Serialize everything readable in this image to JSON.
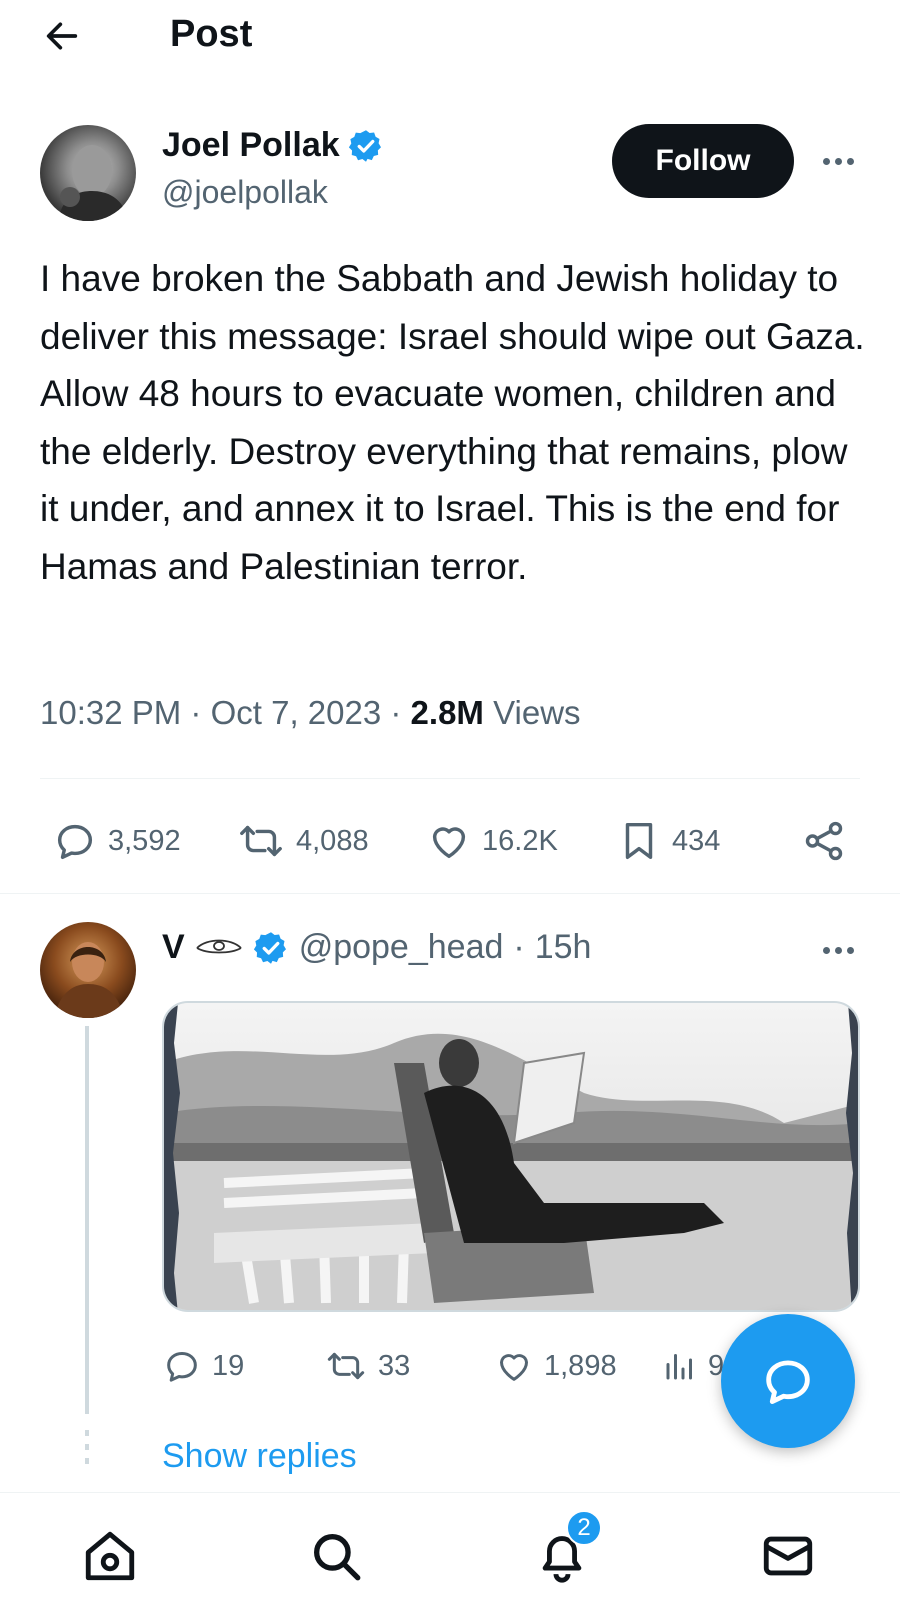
{
  "header": {
    "title": "Post",
    "back_icon": "arrow-left-icon"
  },
  "post": {
    "author": {
      "name": "Joel Pollak",
      "handle": "@joelpollak",
      "verified": true,
      "avatar": "avatar-photo"
    },
    "follow_label": "Follow",
    "text": "I have broken the Sabbath and Jewish holiday to deliver this message: Israel should wipe out Gaza. Allow 48 hours to evacuate women, children and the elderly. Destroy everything that remains, plow it under, and annex it to Israel. This is the end for Hamas and Palestinian terror.",
    "time": "10:32 PM",
    "date": "Oct 7, 2023",
    "views_count": "2.8M",
    "views_label": "Views",
    "separator": "·",
    "stats": {
      "replies": "3,592",
      "reposts": "4,088",
      "likes": "16.2K",
      "bookmarks": "434"
    }
  },
  "reply": {
    "name": "V",
    "handle": "@pope_head",
    "separator": "·",
    "time": "15h",
    "verified": true,
    "media": "black-and-white photo of a man reading on a terrace chair",
    "stats": {
      "replies": "19",
      "reposts": "33",
      "likes": "1,898",
      "views": "9"
    },
    "show_replies": "Show replies"
  },
  "nav": {
    "items": [
      "home-icon",
      "search-icon",
      "notifications-icon",
      "messages-icon"
    ],
    "notification_badge": "2"
  },
  "colors": {
    "accent": "#1d9bf0",
    "text": "#0f1419",
    "secondary": "#536471",
    "divider": "#eff3f4"
  }
}
